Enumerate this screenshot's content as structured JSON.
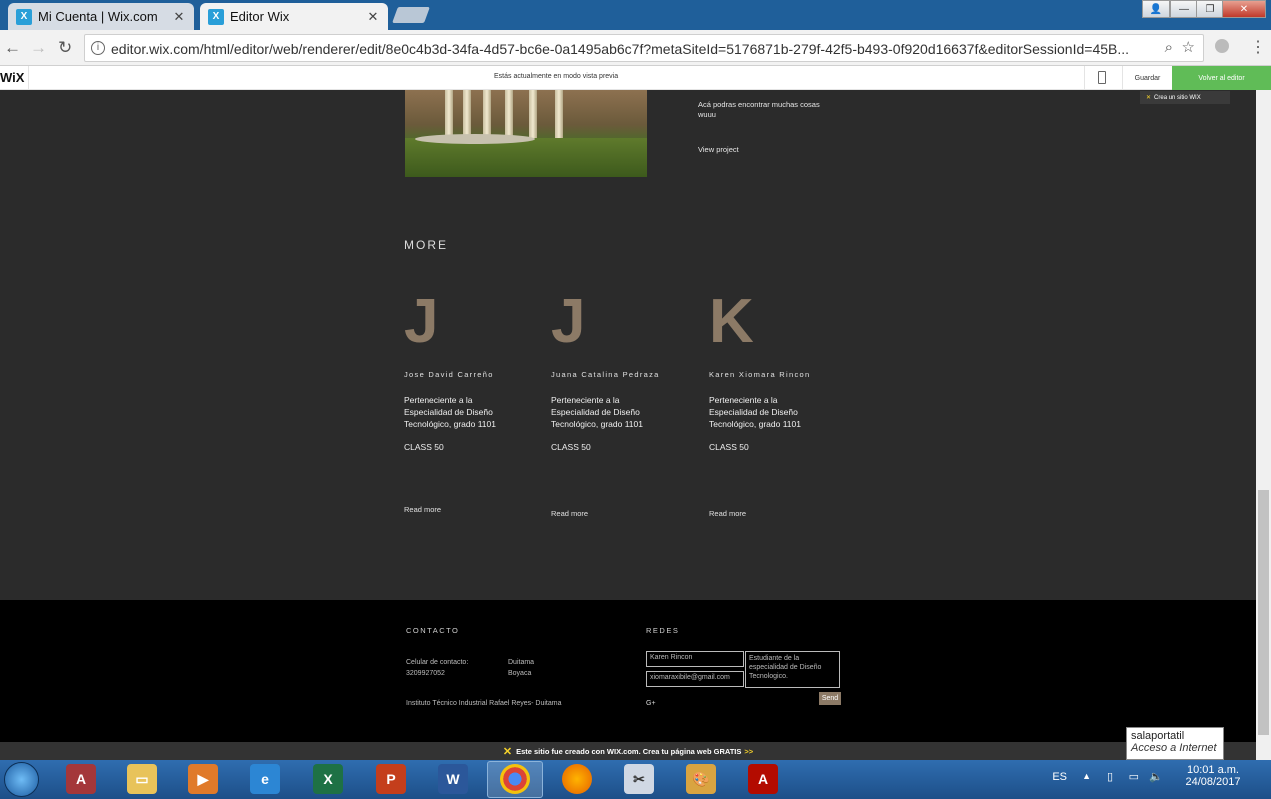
{
  "browser": {
    "tabs": [
      {
        "title": "Mi Cuenta | Wix.com",
        "active": false
      },
      {
        "title": "Editor Wix",
        "active": true
      }
    ],
    "url": "editor.wix.com/html/editor/web/renderer/edit/8e0c4b3d-34fa-4d57-bc6e-0a1495ab6c7f?metaSiteId=5176871b-279f-42f5-b493-0f920d16637f&editorSessionId=45B..."
  },
  "wixbar": {
    "logo": "WiX",
    "preview_text": "Estás actualmente en modo vista previa",
    "save_label": "Guardar",
    "back_label": "Volver al editor"
  },
  "project": {
    "description": "Acá podras encontrar muchas cosas wuuu",
    "link": "View project",
    "badge": "Crea un sitio WIX"
  },
  "more": {
    "title": "MORE",
    "cards": [
      {
        "letter": "J",
        "name": "Jose David Carreño",
        "desc": "Perteneciente a la Especialidad de Diseño Tecnológico, grado 1101",
        "cls": "CLASS 50",
        "read": "Read more"
      },
      {
        "letter": "J",
        "name": "Juana Catalina Pedraza",
        "desc": "Perteneciente a la Especialidad de Diseño Tecnológico, grado 1101",
        "cls": "CLASS 50",
        "read": "Read more"
      },
      {
        "letter": "K",
        "name": "Karen Xiomara Rincon",
        "desc": "Perteneciente a la Especialidad de Diseño Tecnológico, grado 1101",
        "cls": "CLASS 50",
        "read": "Read more"
      }
    ]
  },
  "footer": {
    "contact_title": "CONTACTO",
    "contact_label": "Celular de contacto:",
    "contact_phone": "3209927052",
    "city": "Duitama",
    "region": "Boyaca",
    "institute": "Instituto Técnico Industrial Rafael Reyes- Duitama",
    "social_title": "REDES",
    "name_value": "Karen Rincon",
    "email_value": "xiomaraxibile@gmail.com",
    "message_value": "Estudiante de la especialidad de Diseño Tecnologico.",
    "send_label": "Send",
    "gplus": "G+"
  },
  "banner": {
    "text": "Este sitio fue creado con WIX.com. Crea tu página web GRATIS",
    "arrow": ">>"
  },
  "tooltip": {
    "line1": "salaportatil",
    "line2": "Acceso a Internet"
  },
  "taskbar": {
    "lang": "ES",
    "time": "10:01 a.m.",
    "date": "24/08/2017"
  }
}
